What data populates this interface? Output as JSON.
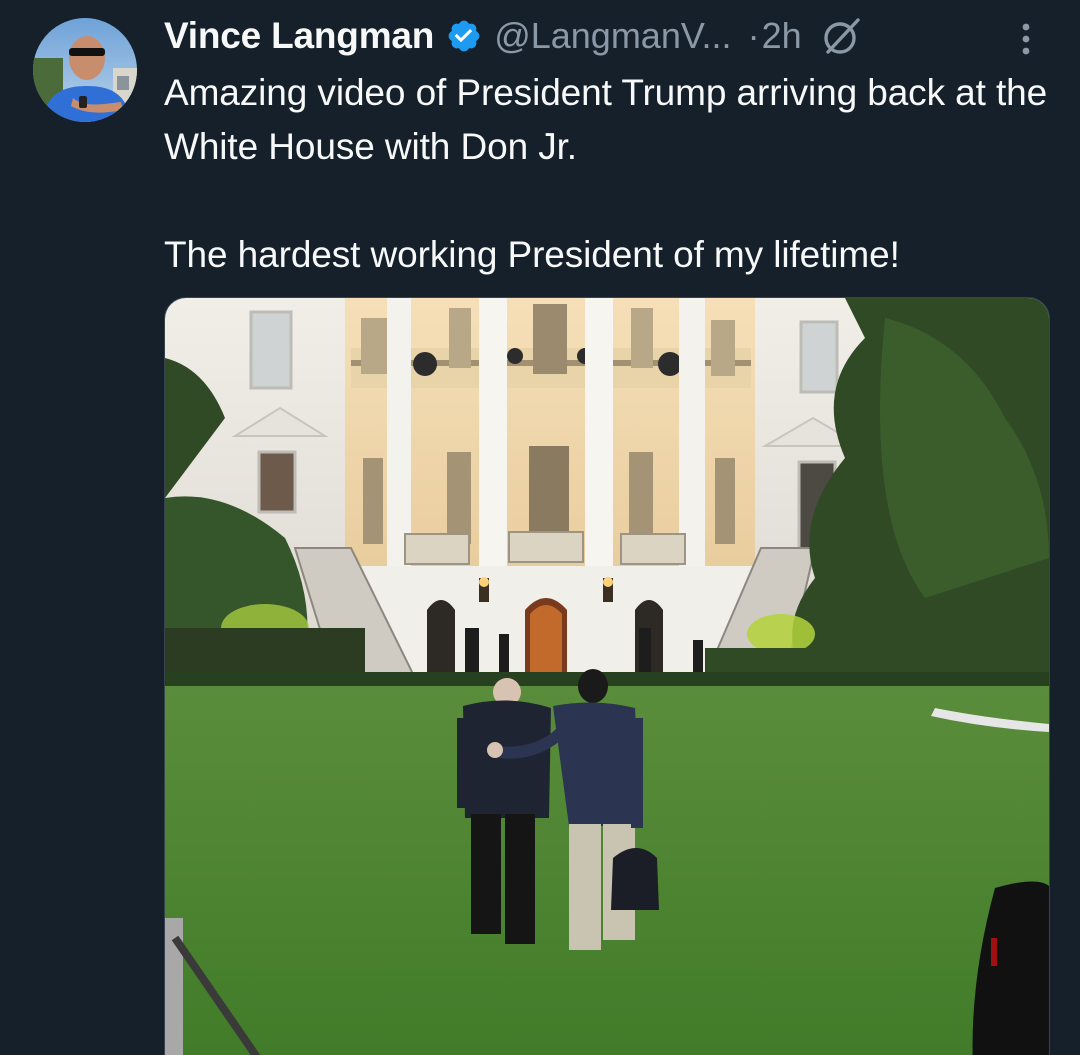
{
  "author": {
    "display_name": "Vince Langman",
    "handle": "@LangmanV...",
    "verified_icon": "verified-badge-icon",
    "avatar_icon": "avatar"
  },
  "meta": {
    "separator": "·",
    "time": "2h",
    "grok_icon": "grok-icon",
    "more_icon": "more-options-icon"
  },
  "tweet": {
    "line1": "Amazing video of President Trump arriving back at the White House with Don Jr.",
    "line2": "The hardest working President of my lifetime!"
  },
  "media": {
    "type": "video-thumbnail",
    "subject": "white-house-lawn-scene"
  },
  "colors": {
    "background": "#15202b",
    "primary_text": "#f7f9f9",
    "secondary_text": "#8b98a5",
    "verified_blue": "#1d9bf0"
  }
}
